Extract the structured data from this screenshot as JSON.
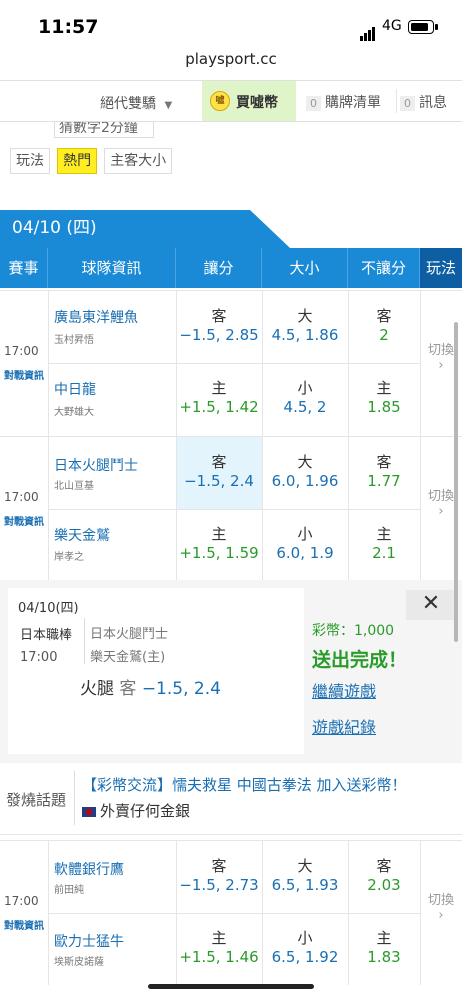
{
  "status_bar": {
    "time": "11:57",
    "network": "4G"
  },
  "browser": {
    "url": "playsport.cc"
  },
  "top_nav": {
    "sort_label": "絕代雙驕",
    "buy_label": "買噓幣",
    "coin_text": "噓",
    "cart_count": "0",
    "cart_label": "購牌清單",
    "msg_count": "0",
    "msg_label": "訊息"
  },
  "filter": {
    "partial_text": "猜數字2分鐘",
    "label": "玩法",
    "chips": [
      "熱門",
      "主客大小"
    ]
  },
  "date_banner": "04/10 (四)",
  "table_headers": {
    "event": "賽事",
    "team_info": "球隊資訊",
    "spread": "讓分",
    "total": "大小",
    "moneyline": "不讓分",
    "play": "玩法"
  },
  "games": [
    {
      "time": "17:00",
      "link": "對戰資訊",
      "switch": "切換",
      "away": {
        "team": "廣島東洋鯉魚",
        "pitcher": "玉村昇悟",
        "spread_side": "客",
        "spread_line": "−1.5, 2.85",
        "total_side": "大",
        "total_line": "4.5, 1.86",
        "ml_side": "客",
        "ml_odds": "2"
      },
      "home": {
        "team": "中日龍",
        "pitcher": "大野雄大",
        "spread_side": "主",
        "spread_line": "+1.5, 1.42",
        "total_side": "小",
        "total_line": "4.5, 2",
        "ml_side": "主",
        "ml_odds": "1.85"
      }
    },
    {
      "time": "17:00",
      "link": "對戰資訊",
      "switch": "切換",
      "away": {
        "team": "日本火腿鬥士",
        "pitcher": "北山亘基",
        "spread_side": "客",
        "spread_line": "−1.5, 2.4",
        "total_side": "大",
        "total_line": "6.0, 1.96",
        "ml_side": "客",
        "ml_odds": "1.77"
      },
      "home": {
        "team": "樂天金鷲",
        "pitcher": "岸孝之",
        "spread_side": "主",
        "spread_line": "+1.5, 1.59",
        "total_side": "小",
        "total_line": "6.0, 1.9",
        "ml_side": "主",
        "ml_odds": "2.1"
      }
    },
    {
      "time": "17:00",
      "link": "對戰資訊",
      "switch": "切換",
      "away": {
        "team": "軟體銀行鷹",
        "pitcher": "前田純",
        "spread_side": "客",
        "spread_line": "−1.5, 2.73",
        "total_side": "大",
        "total_line": "6.5, 1.93",
        "ml_side": "客",
        "ml_odds": "2.03"
      },
      "home": {
        "team": "歐力士猛牛",
        "pitcher": "埃斯皮諾薩",
        "spread_side": "主",
        "spread_line": "+1.5, 1.46",
        "total_side": "小",
        "total_line": "6.5, 1.92",
        "ml_side": "主",
        "ml_odds": "1.83"
      }
    }
  ],
  "bet_popup": {
    "date": "04/10(四)",
    "league": "日本職棒",
    "time": "17:00",
    "team_away": "日本火腿鬥士",
    "team_home": "樂天金鷲(主)",
    "bet_team": "火腿",
    "bet_side": "客",
    "bet_line": "−1.5, 2.4",
    "coins_text": "彩幣：1,000",
    "success": "送出完成！",
    "continue_link": "繼續遊戲",
    "record_link": "遊戲紀錄",
    "close": "✕"
  },
  "hot_topic": {
    "label": "發燒話題",
    "title": "【彩幣交流】懦夫救星 中國古拳法 加入送彩幣！",
    "subtitle": "外賣仔何金銀"
  },
  "colors": {
    "primary": "#1a8ad6",
    "dark_primary": "#0d5ea3",
    "link": "#1a6fb3",
    "odds_green": "#2a9b2a",
    "highlight": "#e3f4fd",
    "chip_hot": "#ffee22"
  }
}
